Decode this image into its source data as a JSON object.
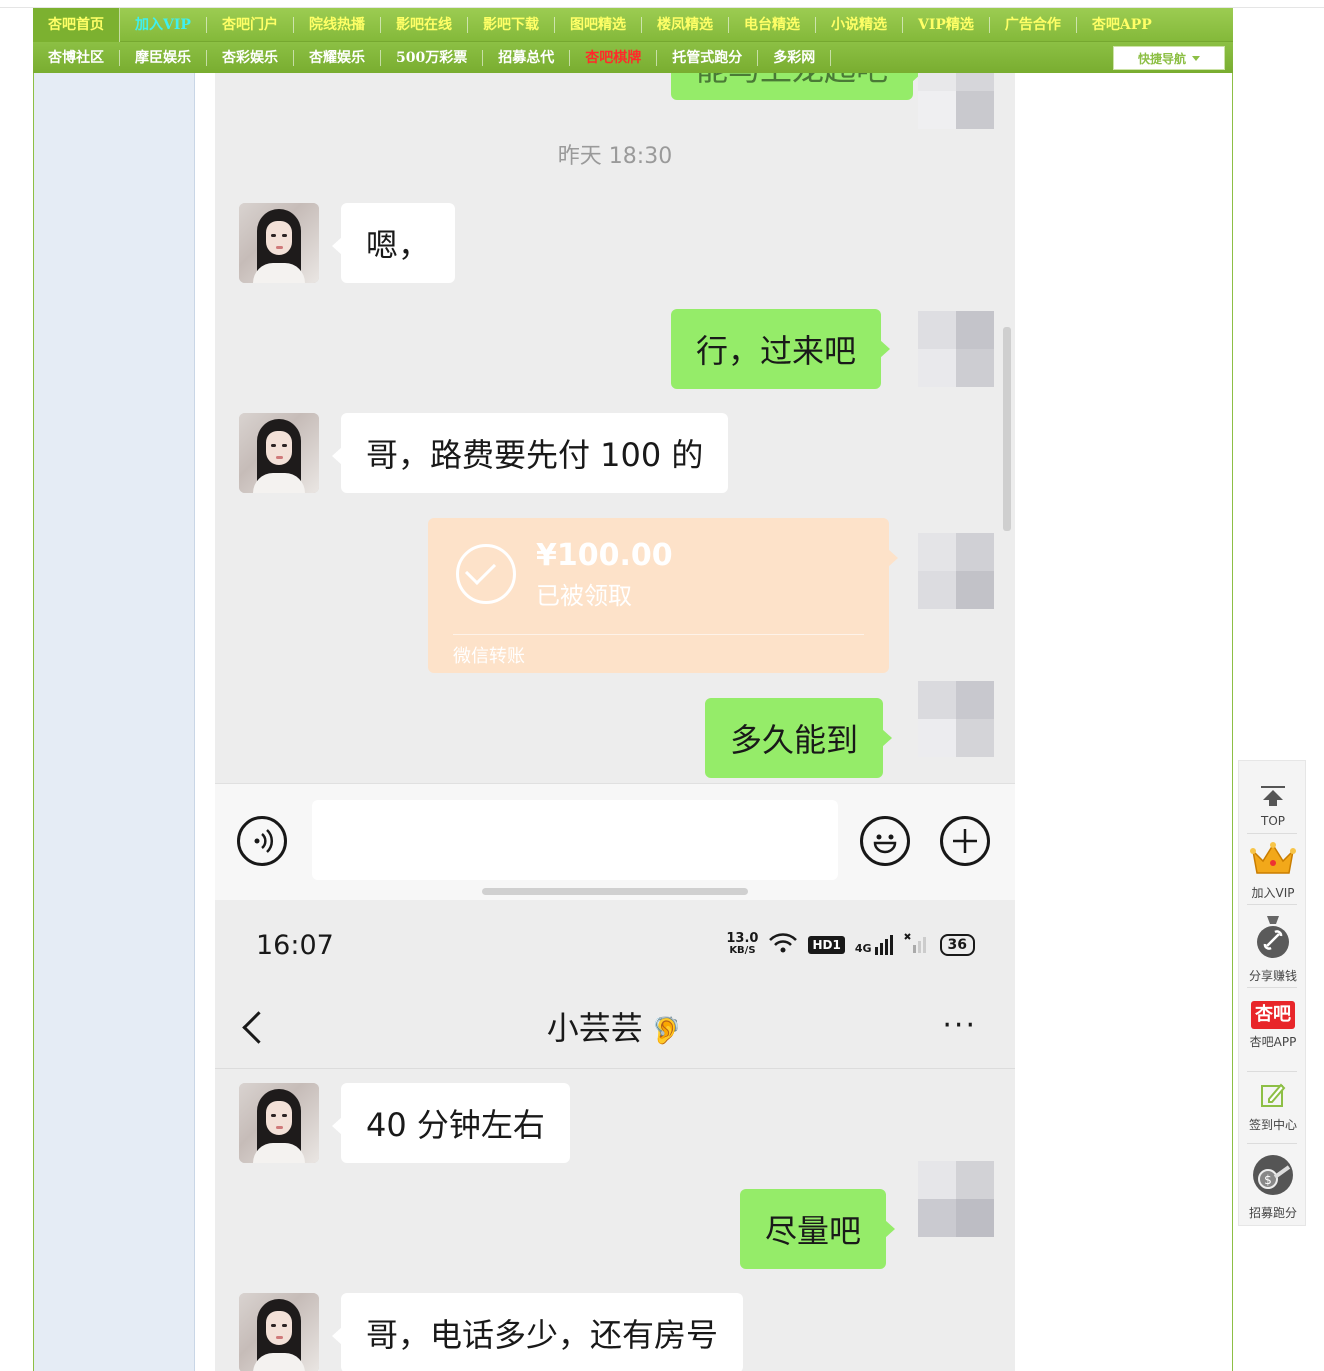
{
  "nav": {
    "row1": [
      "杏吧首页",
      "加入VIP",
      "杏吧门户",
      "院线热播",
      "影吧在线",
      "影吧下载",
      "图吧精选",
      "楼凤精选",
      "电台精选",
      "小说精选",
      "VIP精选",
      "广告合作",
      "杏吧APP"
    ],
    "row2": [
      "杏博社区",
      "摩臣娱乐",
      "杏彩娱乐",
      "杏耀娱乐",
      "500万彩票",
      "招募总代",
      "杏吧棋牌",
      "托管式跑分",
      "多彩网"
    ],
    "quick_nav": "快捷导航"
  },
  "chat": {
    "top_partial": "能马上龙起吧",
    "time_label": "昨天 18:30",
    "msg1": "嗯，",
    "msg2": "行，过来吧",
    "msg3": "哥，路费要先付 100 的",
    "transfer": {
      "amount": "¥100.00",
      "status": "已被领取",
      "footer": "微信转账"
    },
    "msg4": "多久能到",
    "status_time": "16:07",
    "net_speed_value": "13.0",
    "net_speed_unit": "KB/S",
    "hd_label": "HD1",
    "signal_label": "4G",
    "battery": "36",
    "contact_name": "小芸芸",
    "more_label": "···",
    "msg5": "40 分钟左右",
    "msg6": "尽量吧",
    "msg7": "哥，电话多少，还有房号"
  },
  "toolbar": {
    "top": "TOP",
    "vip": "加入VIP",
    "share": "分享赚钱",
    "app_logo": "杏吧",
    "app": "杏吧APP",
    "checkin": "签到中心",
    "recruit": "招募跑分"
  },
  "colors": {
    "nav_green": "#8dbf45",
    "wechat_green": "#95ec69",
    "transfer_orange": "#fde2c9",
    "sidebar_blue": "#e5ecf5"
  }
}
